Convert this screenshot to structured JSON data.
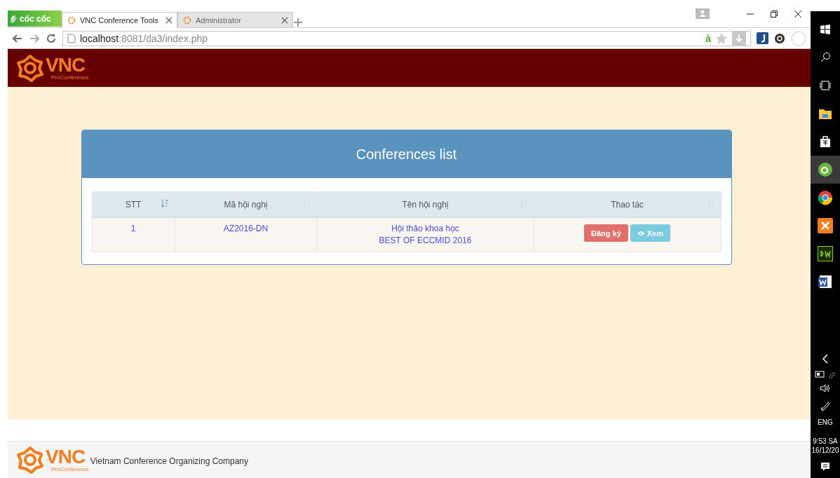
{
  "browser": {
    "brand": "cốc cốc",
    "tabs": [
      {
        "title": "VNC Conference Tools",
        "selected": true
      },
      {
        "title": "Administrator",
        "selected": false
      }
    ],
    "url": {
      "host": "localhost",
      "path": ":8081/da3/index.php"
    },
    "address_icon": "à"
  },
  "header": {
    "logo": "VNC",
    "tagline": "ProConference"
  },
  "panel": {
    "title": "Conferences list",
    "table": {
      "columns": [
        {
          "label": "STT",
          "sorted": true
        },
        {
          "label": "Mã hội nghị",
          "sorted": false
        },
        {
          "label": "Tên hội nghị",
          "sorted": false
        },
        {
          "label": "Thao tác",
          "sorted": false
        }
      ],
      "rows": [
        {
          "stt": "1",
          "code": "AZ2016-DN",
          "name": [
            "Hội thảo khoa học",
            "BEST OF ECCMID 2016"
          ],
          "actions": [
            {
              "kind": "register",
              "label": "Đăng ký"
            },
            {
              "kind": "view",
              "label": "Xem"
            }
          ]
        }
      ]
    }
  },
  "footer": {
    "logo": "VNC",
    "tagline": "ProConference",
    "company": "Vietnam Conference Organizing Company"
  },
  "taskbar": {
    "language": "ENG",
    "time": "9:53 SA",
    "date": "16/12/20"
  }
}
